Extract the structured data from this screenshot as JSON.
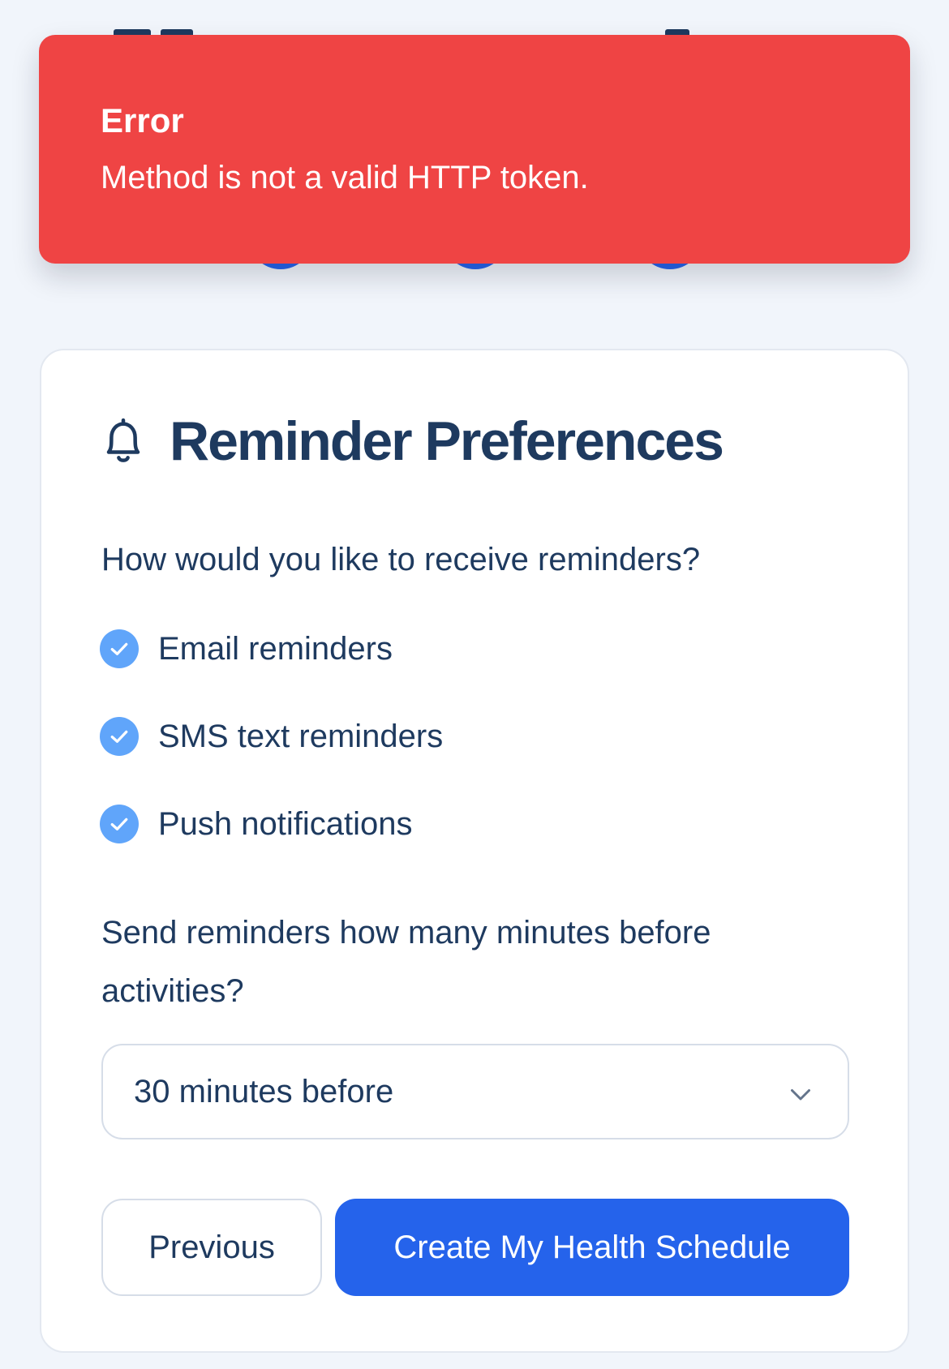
{
  "toast": {
    "title": "Error",
    "message": "Method is not a valid HTTP token.",
    "color": "#ef4444"
  },
  "card": {
    "icon": "bell-icon",
    "title": "Reminder Preferences",
    "methods_question": "How would you like to receive reminders?",
    "options": [
      {
        "label": "Email reminders",
        "checked": true
      },
      {
        "label": "SMS text reminders",
        "checked": true
      },
      {
        "label": "Push notifications",
        "checked": true
      }
    ],
    "timing_question": "Send reminders how many minutes before activities?",
    "timing_select": {
      "value": "30 minutes before"
    },
    "buttons": {
      "previous": "Previous",
      "submit": "Create My Health Schedule"
    }
  },
  "colors": {
    "primary": "#2563eb",
    "checkbox": "#60a5fa",
    "text": "#1e3a5f",
    "background": "#f1f5fb"
  }
}
